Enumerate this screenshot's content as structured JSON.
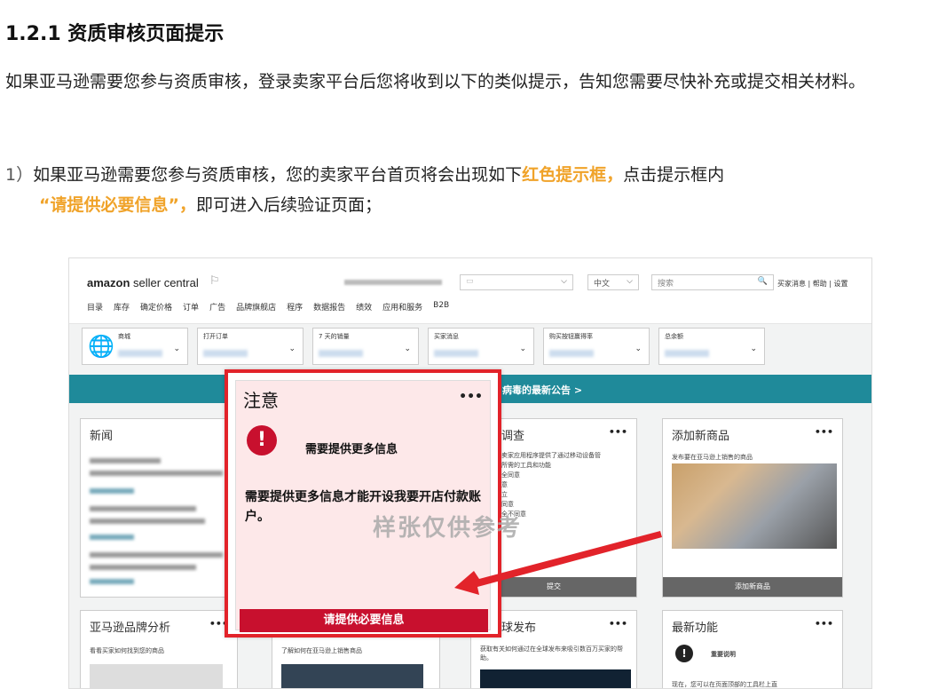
{
  "heading": "1.2.1 资质审核页面提示",
  "intro": "如果亚马逊需要您参与资质审核，登录卖家平台后您将收到以下的类似提示，告知您需要尽快补充或提交相关材料。",
  "step1": {
    "num": "1）",
    "a": "如果亚马逊需要您参与资质审核，您的卖家平台首页将会出现如下",
    "red_box": "红色提示框，",
    "b": "点击提示框内",
    "quote": "“请提供必要信息”",
    "c": "，",
    "d": "即可进入后续验证页面；"
  },
  "screenshot": {
    "logo_bold": "amazon",
    "logo_rest": " seller central",
    "lang": "中文",
    "search_placeholder": "搜索",
    "top_links": "买家消息 | 帮助 | 设置",
    "nav": [
      "目录",
      "库存",
      "确定价格",
      "订单",
      "广告",
      "品牌旗舰店",
      "程序",
      "数据报告",
      "绩效",
      "应用和服务",
      "B2B"
    ],
    "cards": [
      "商城",
      "打开订单",
      "7 天的销量",
      "买家消息",
      "购买按钮赢得率",
      "总余额"
    ],
    "banner": "病毒的最新公告 >",
    "panes": {
      "news": "新闻",
      "survey": "调查",
      "survey_lines": [
        "卖家应用程序提供了通过移动设备管",
        "所需的工具和功能",
        "全同意",
        "意",
        "立",
        "同意",
        "全不同意"
      ],
      "submit": "提交",
      "add_product": "添加新商品",
      "add_product_desc": "发布要在亚马逊上销售的商品",
      "add_product_btn": "添加新商品",
      "brand": "亚马逊品牌分析",
      "brand_desc": "看看买家如何找到您的商品",
      "learn": "了解如何在亚马逊上销售商品",
      "global": "球发布",
      "global_desc": "获取有关如何通过在全球发布来吸引数百万买家的帮助。",
      "latest": "最新功能",
      "latest_item": "重要说明",
      "latest_desc": "现在，您可以在页面顶部的工具栏上直"
    },
    "modal": {
      "title": "注意",
      "menu": "•••",
      "alert_icon": "!",
      "heading": "需要提供更多信息",
      "body": "需要提供更多信息才能开设我要开店付款账户。",
      "button": "请提供必要信息"
    },
    "watermark": "样张仅供参考"
  }
}
